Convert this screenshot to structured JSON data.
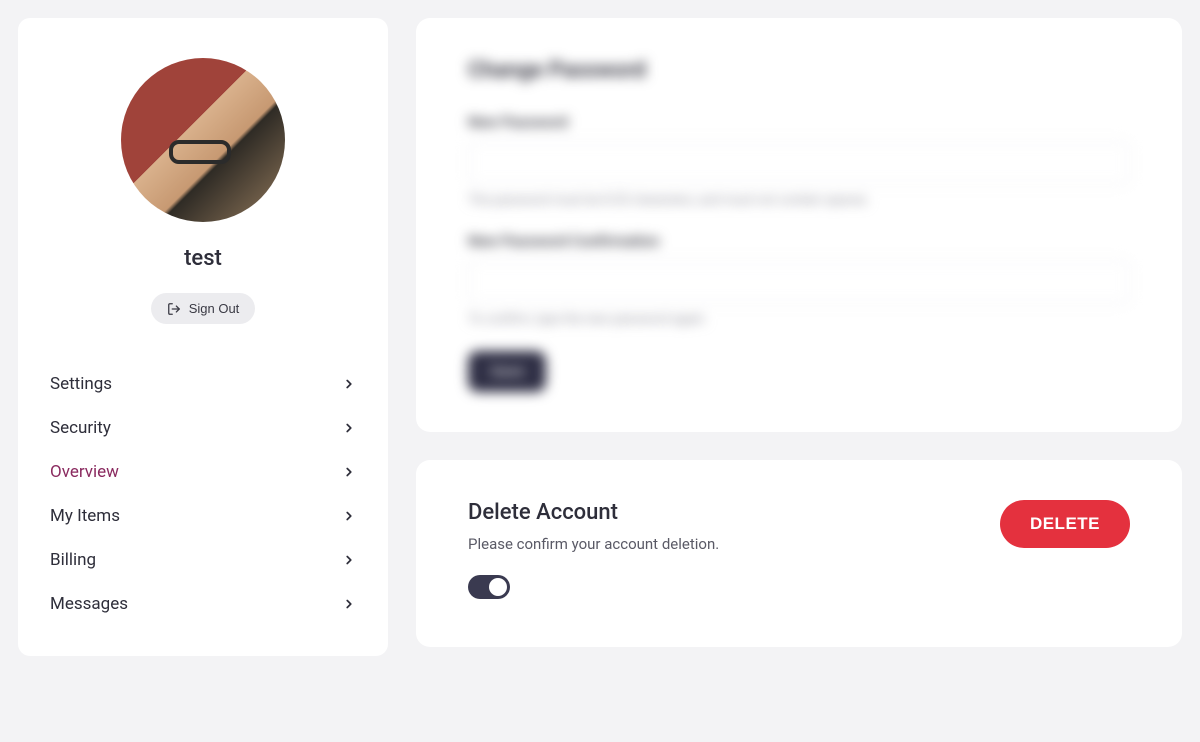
{
  "sidebar": {
    "username": "test",
    "signout_label": "Sign Out",
    "items": [
      {
        "label": "Settings",
        "active": false
      },
      {
        "label": "Security",
        "active": false
      },
      {
        "label": "Overview",
        "active": true
      },
      {
        "label": "My Items",
        "active": false
      },
      {
        "label": "Billing",
        "active": false
      },
      {
        "label": "Messages",
        "active": false
      }
    ]
  },
  "password_card": {
    "title": "Change Password",
    "new_label": "New Password",
    "new_hint": "The password must be 8-20 characters, and must not contain spaces.",
    "confirm_label": "New Password Confirmation",
    "confirm_hint": "To confirm, type the new password again.",
    "save_label": "Save"
  },
  "delete_card": {
    "title": "Delete Account",
    "description": "Please confirm your account deletion.",
    "button_label": "DELETE"
  }
}
